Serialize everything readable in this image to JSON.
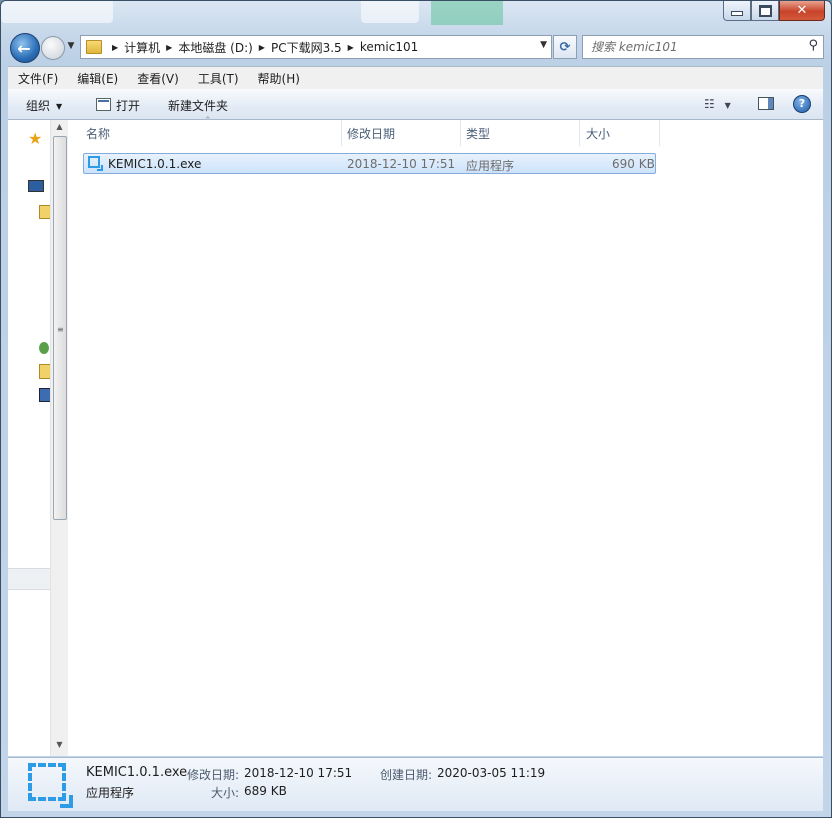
{
  "window": {
    "address": {
      "segments": [
        "计算机",
        "本地磁盘 (D:)",
        "PC下载网3.5",
        "kemic101"
      ]
    },
    "search": {
      "placeholder": "搜索 kemic101"
    }
  },
  "menu": [
    "文件(F)",
    "编辑(E)",
    "查看(V)",
    "工具(T)",
    "帮助(H)"
  ],
  "toolbar": {
    "organize": "组织",
    "open": "打开",
    "new_folder": "新建文件夹"
  },
  "columns": [
    "名称",
    "修改日期",
    "类型",
    "大小"
  ],
  "files": [
    {
      "name": "KEMIC1.0.1.exe",
      "modified": "2018-12-10 17:51",
      "type": "应用程序",
      "size": "690 KB",
      "selected": true
    }
  ],
  "details": {
    "name": "KEMIC1.0.1.exe",
    "type": "应用程序",
    "modified_label": "修改日期:",
    "modified": "2018-12-10 17:51",
    "created_label": "创建日期:",
    "created": "2020-03-05 11:19",
    "size_label": "大小:",
    "size": "689 KB"
  },
  "colors": {
    "selection": "#cde3fb",
    "accent": "#2e9be6",
    "close": "#c7442a"
  },
  "icons": [
    "back-icon",
    "forward-icon",
    "folder-icon",
    "refresh-icon",
    "search-icon",
    "open-icon",
    "views-icon",
    "preview-pane-icon",
    "help-icon",
    "exe-icon",
    "favorites-star-icon"
  ]
}
